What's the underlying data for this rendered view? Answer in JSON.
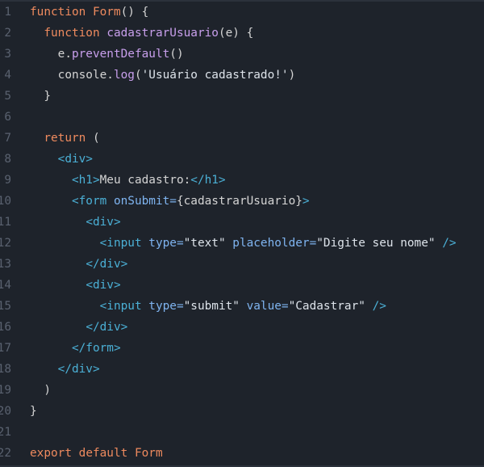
{
  "theme": {
    "background": "#1e232b",
    "keyword": "#ee8a5e",
    "function": "#c89fec",
    "tag": "#4bb0d6",
    "attribute": "#7fb4f0",
    "text": "#d4d4d4",
    "gutter": "#5a6270"
  },
  "lines": [
    {
      "num": "1",
      "tokens": [
        [
          "kw",
          "function"
        ],
        [
          "txt",
          " "
        ],
        [
          "kw",
          "Form"
        ],
        [
          "txt",
          "() {"
        ]
      ]
    },
    {
      "num": "2",
      "tokens": [
        [
          "txt",
          "  "
        ],
        [
          "kw",
          "function"
        ],
        [
          "txt",
          " "
        ],
        [
          "fn",
          "cadastrarUsuario"
        ],
        [
          "txt",
          "(e) {"
        ]
      ]
    },
    {
      "num": "3",
      "tokens": [
        [
          "txt",
          "    e."
        ],
        [
          "fn",
          "preventDefault"
        ],
        [
          "txt",
          "()"
        ]
      ]
    },
    {
      "num": "4",
      "tokens": [
        [
          "txt",
          "    console."
        ],
        [
          "fn",
          "log"
        ],
        [
          "txt",
          "("
        ],
        [
          "str",
          "'Usuário cadastrado!'"
        ],
        [
          "txt",
          ")"
        ]
      ]
    },
    {
      "num": "5",
      "tokens": [
        [
          "txt",
          "  }"
        ]
      ]
    },
    {
      "num": "6",
      "tokens": []
    },
    {
      "num": "7",
      "tokens": [
        [
          "txt",
          "  "
        ],
        [
          "kw",
          "return"
        ],
        [
          "txt",
          " ("
        ]
      ]
    },
    {
      "num": "8",
      "tokens": [
        [
          "txt",
          "    "
        ],
        [
          "tag",
          "<div>"
        ]
      ]
    },
    {
      "num": "9",
      "tokens": [
        [
          "txt",
          "      "
        ],
        [
          "tag",
          "<h1>"
        ],
        [
          "txt",
          "Meu cadastro:"
        ],
        [
          "tag",
          "</h1>"
        ]
      ]
    },
    {
      "num": "10",
      "tokens": [
        [
          "txt",
          "      "
        ],
        [
          "tag",
          "<form"
        ],
        [
          "txt",
          " "
        ],
        [
          "attr",
          "onSubmit="
        ],
        [
          "txt",
          "{cadastrarUsuario}"
        ],
        [
          "tag",
          ">"
        ]
      ]
    },
    {
      "num": "11",
      "tokens": [
        [
          "txt",
          "        "
        ],
        [
          "tag",
          "<div>"
        ]
      ]
    },
    {
      "num": "12",
      "tokens": [
        [
          "txt",
          "          "
        ],
        [
          "tag",
          "<input"
        ],
        [
          "txt",
          " "
        ],
        [
          "attr",
          "type="
        ],
        [
          "str",
          "\"text\""
        ],
        [
          "txt",
          " "
        ],
        [
          "attr",
          "placeholder="
        ],
        [
          "str",
          "\"Digite seu nome\""
        ],
        [
          "txt",
          " "
        ],
        [
          "tag",
          "/>"
        ]
      ]
    },
    {
      "num": "13",
      "tokens": [
        [
          "txt",
          "        "
        ],
        [
          "tag",
          "</div>"
        ]
      ]
    },
    {
      "num": "14",
      "tokens": [
        [
          "txt",
          "        "
        ],
        [
          "tag",
          "<div>"
        ]
      ]
    },
    {
      "num": "15",
      "tokens": [
        [
          "txt",
          "          "
        ],
        [
          "tag",
          "<input"
        ],
        [
          "txt",
          " "
        ],
        [
          "attr",
          "type="
        ],
        [
          "str",
          "\"submit\""
        ],
        [
          "txt",
          " "
        ],
        [
          "attr",
          "value="
        ],
        [
          "str",
          "\"Cadastrar\""
        ],
        [
          "txt",
          " "
        ],
        [
          "tag",
          "/>"
        ]
      ]
    },
    {
      "num": "16",
      "tokens": [
        [
          "txt",
          "        "
        ],
        [
          "tag",
          "</div>"
        ]
      ]
    },
    {
      "num": "17",
      "tokens": [
        [
          "txt",
          "      "
        ],
        [
          "tag",
          "</form>"
        ]
      ]
    },
    {
      "num": "18",
      "tokens": [
        [
          "txt",
          "    "
        ],
        [
          "tag",
          "</div>"
        ]
      ]
    },
    {
      "num": "19",
      "tokens": [
        [
          "txt",
          "  )"
        ]
      ]
    },
    {
      "num": "20",
      "tokens": [
        [
          "txt",
          "}"
        ]
      ]
    },
    {
      "num": "21",
      "tokens": []
    },
    {
      "num": "22",
      "tokens": [
        [
          "kw",
          "export"
        ],
        [
          "txt",
          " "
        ],
        [
          "kw",
          "default"
        ],
        [
          "txt",
          " "
        ],
        [
          "kw",
          "Form"
        ]
      ]
    }
  ]
}
